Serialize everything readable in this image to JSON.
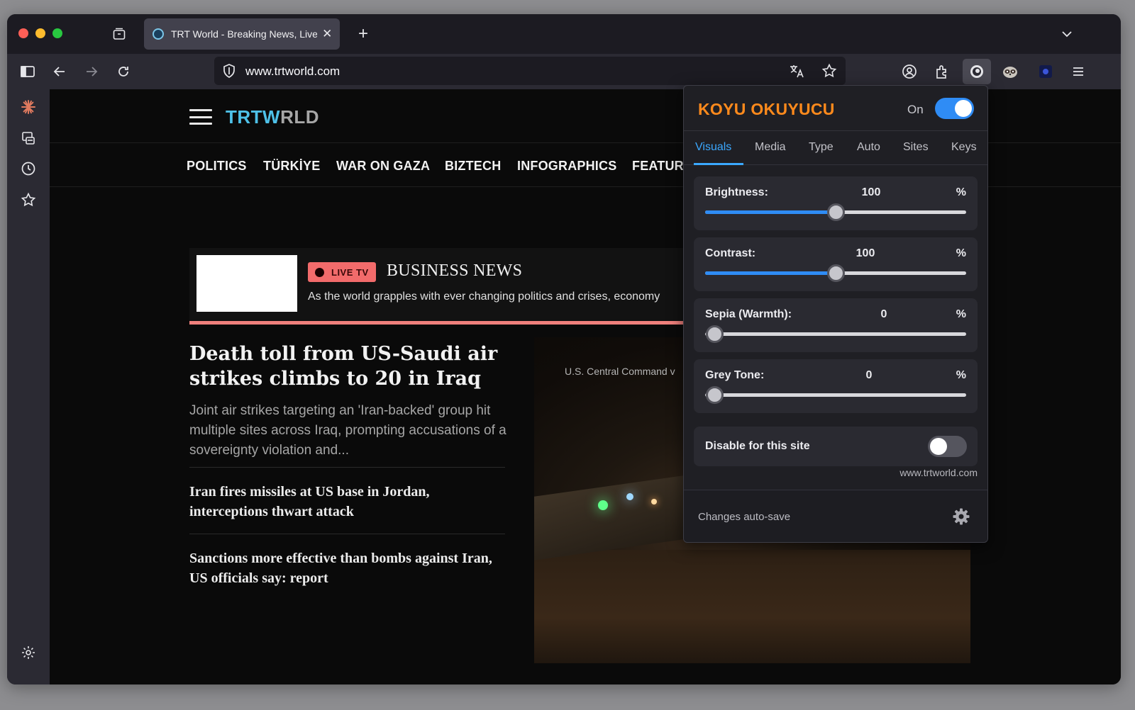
{
  "browser": {
    "tab": {
      "title": "TRT World - Breaking News, Live"
    },
    "url": "www.trtworld.com"
  },
  "site": {
    "logo": {
      "part1": "TRT",
      "part2": "W",
      "part3": "RLD"
    },
    "nav": [
      "POLITICS",
      "TÜRKİYE",
      "WAR ON GAZA",
      "BIZTECH",
      "INFOGRAPHICS",
      "FEATURES"
    ],
    "live": {
      "badge": "LIVE TV",
      "title": "BUSINESS NEWS",
      "description": "As the world grapples with ever changing politics and crises, economy"
    },
    "main_story": {
      "headline": "Death toll from US-Saudi air strikes climbs to 20 in Iraq",
      "summary": "Joint air strikes targeting an 'Iran-backed' group hit multiple sites across Iraq, prompting accusations of a sovereignty violation and..."
    },
    "stories": [
      "Iran fires missiles at US base in Jordan, interceptions thwart attack",
      "Sanctions more effective than bombs against Iran, US officials say: report"
    ],
    "photo_caption": "U.S. Central Command v"
  },
  "extension": {
    "title": "KOYU OKUYUCU",
    "power_label": "On",
    "enabled": true,
    "tabs": [
      "Visuals",
      "Media",
      "Type",
      "Auto",
      "Sites",
      "Keys"
    ],
    "active_tab": "Visuals",
    "sliders": [
      {
        "label": "Brightness:",
        "value": "100",
        "unit": "%",
        "fraction": 0.5
      },
      {
        "label": "Contrast:",
        "value": "100",
        "unit": "%",
        "fraction": 0.5
      },
      {
        "label": "Sepia (Warmth):",
        "value": "0",
        "unit": "%",
        "fraction": 0
      },
      {
        "label": "Grey Tone:",
        "value": "0",
        "unit": "%",
        "fraction": 0
      }
    ],
    "disable_site_label": "Disable for this site",
    "disable_site_enabled": false,
    "site_host": "www.trtworld.com",
    "footer_text": "Changes auto-save"
  },
  "colors": {
    "accent_blue": "#2f8cf5",
    "extension_title": "#ff8a1c",
    "trt_blue": "#4ec1e8",
    "live_badge": "#f26b6b"
  }
}
